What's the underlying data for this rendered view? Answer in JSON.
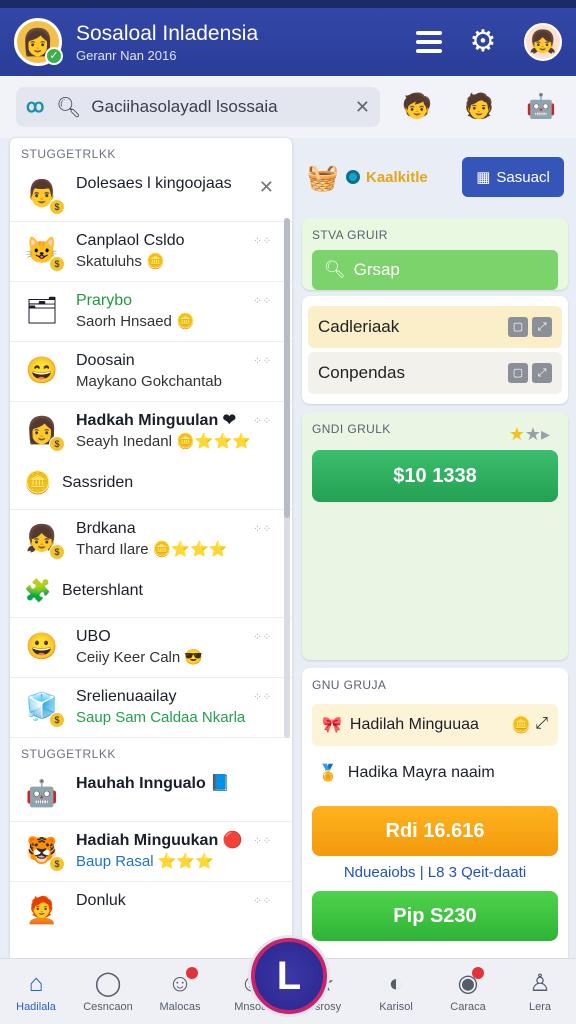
{
  "header": {
    "title": "Sosaloal Inladensia",
    "subtitle": "Geranr Nan 2016"
  },
  "search": {
    "query": "Gaciihasolayadl lsossaia"
  },
  "left_panel": {
    "section1": "STUGGETRLKK",
    "section2": "STUGGETRLKK",
    "rows": [
      {
        "name": "Dolesaes l kingoojaas",
        "meta": ""
      },
      {
        "name": "Canplaol Csldo",
        "meta": "Skatuluhs"
      },
      {
        "name": "Prarybo",
        "meta": "Saorh Hnsaed"
      },
      {
        "name": "Doosain",
        "meta": "Maykano Gokchantab"
      },
      {
        "name": "Hadkah Minguulan",
        "meta": "Seayh Inedanl"
      },
      {
        "name": "Brdkana",
        "meta": "Thard Ilare"
      },
      {
        "name": "UBO",
        "meta": "Ceiiy Keer Caln"
      },
      {
        "name": "Srelienuaailay",
        "meta": "Saup Sam Caldaa Nkarla"
      },
      {
        "name": "Hauhah Inngualo",
        "meta": ""
      },
      {
        "name": "Hadiah Minguukan",
        "meta": "Baup Rasal"
      },
      {
        "name": "Donluk",
        "meta": ""
      }
    ],
    "sub1": "Sassriden",
    "sub2": "Betershlant"
  },
  "right_panel": {
    "toolbar_label": "Kaalkitle",
    "toolbar_button": "Sasuacl",
    "card1_title": "STVA GRUIR",
    "card1_button": "Grsap",
    "item1": "Cadleriaak",
    "item2": "Conpendas",
    "card3_title": "GNDI GRULK",
    "card3_button": "$10 1338",
    "card4_title": "GNU GRUJA",
    "card4_item1": "Hadilah Minguuaa",
    "card4_item2": "Hadika Mayra naaim",
    "card4_button1": "Rdi 16.616",
    "card4_note": "Ndueaiobs | L8 3 Qeit-daati",
    "card4_button2": "Pip S230"
  },
  "bottom_nav": [
    {
      "label": "Hadilala",
      "icon": "home-icon"
    },
    {
      "label": "Cesncaon",
      "icon": "chat-icon"
    },
    {
      "label": "Malocas",
      "icon": "gift-icon"
    },
    {
      "label": "Mnsoal",
      "icon": "person-icon"
    },
    {
      "label": "Dsrosy",
      "icon": "star-icon"
    },
    {
      "label": "Karisol",
      "icon": "message-icon"
    },
    {
      "label": "Caraca",
      "icon": "bell-icon"
    },
    {
      "label": "Lera",
      "icon": "user-icon"
    }
  ],
  "fab_label": "L"
}
